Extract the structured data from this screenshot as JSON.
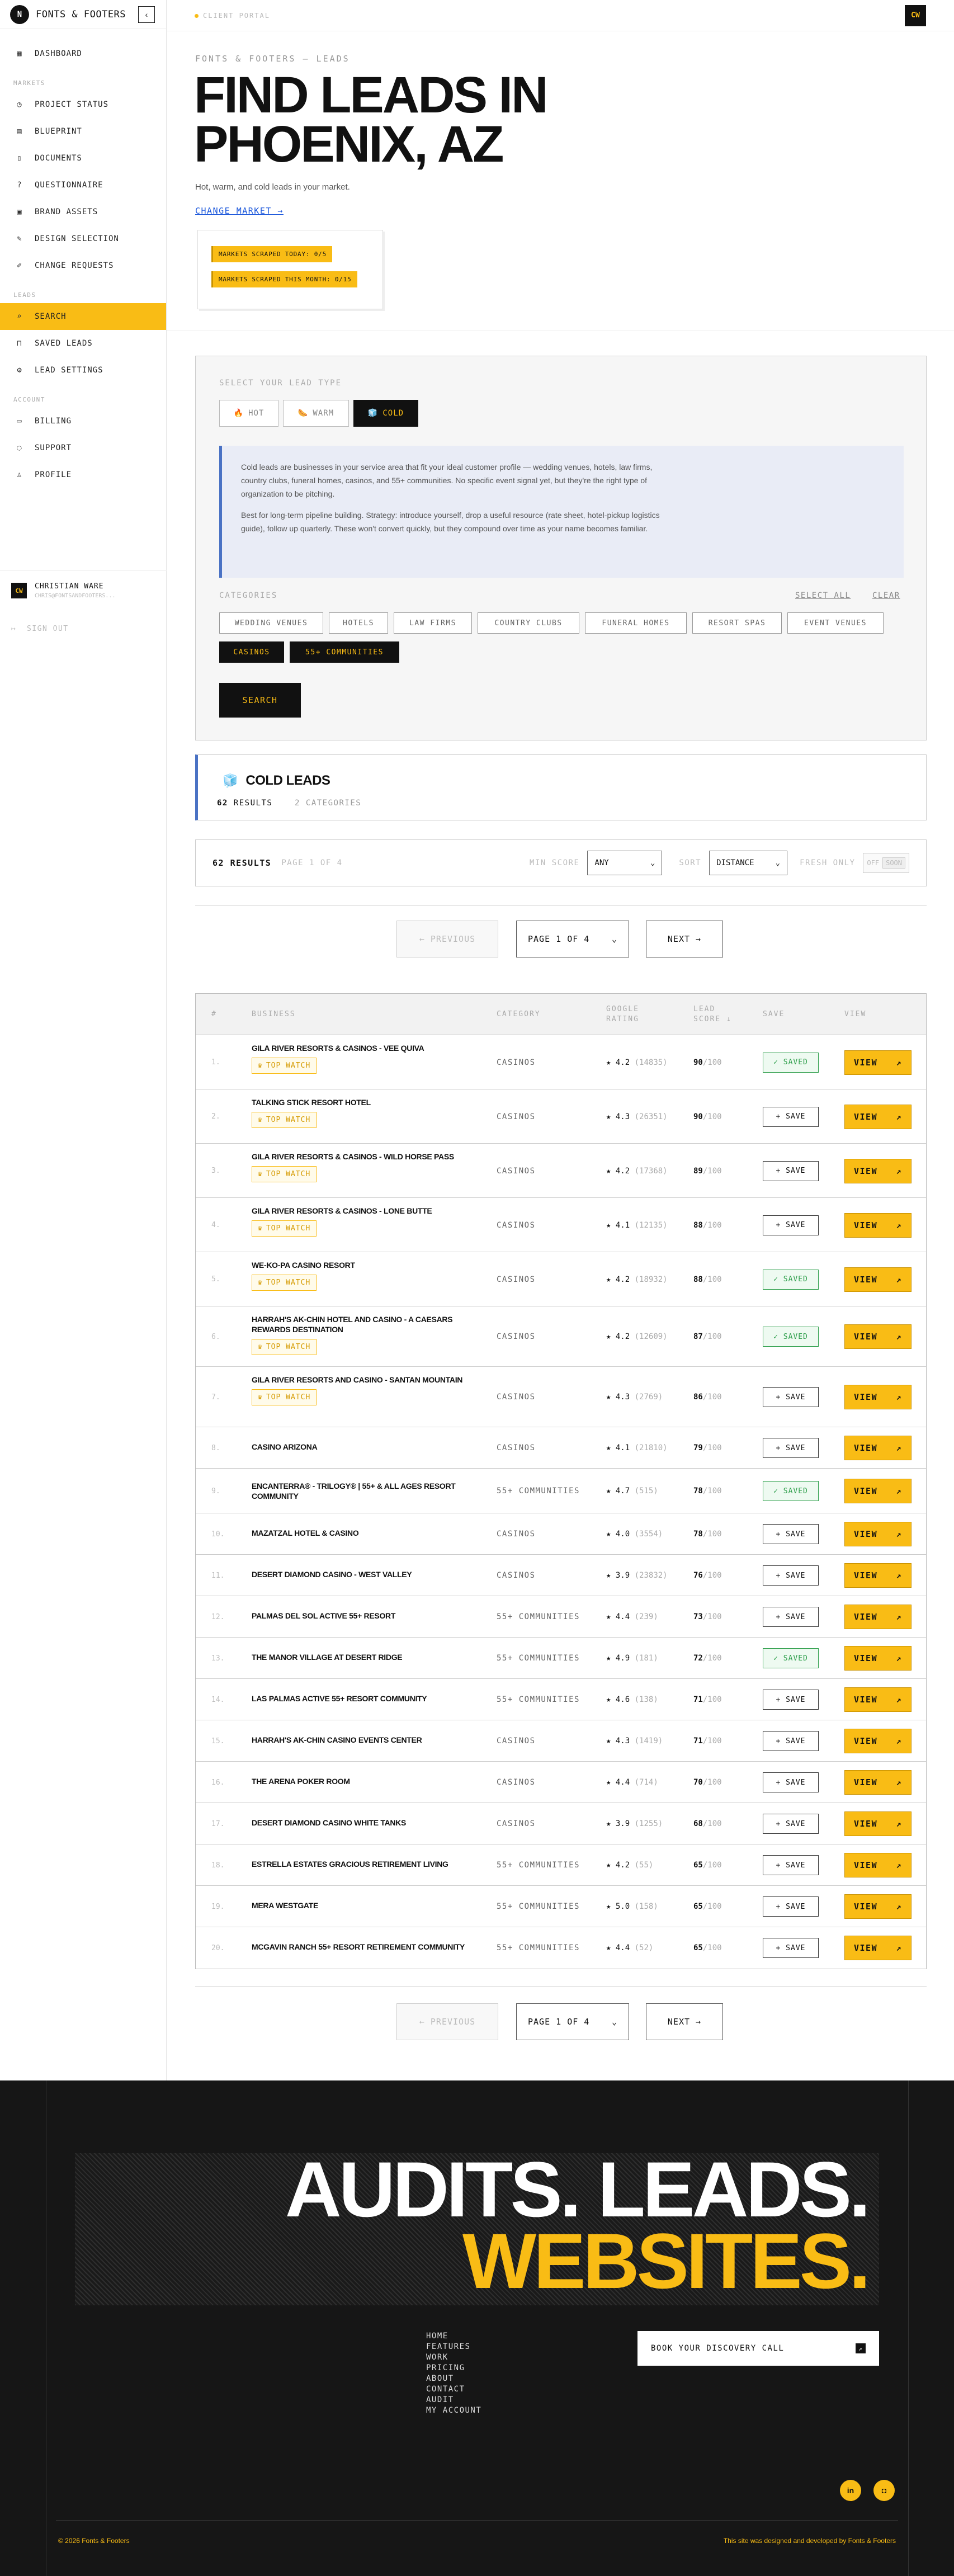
{
  "sidebar": {
    "logo_letter": "N",
    "brand": "FONTS & FOOTERS",
    "collapse_icon": "chevron-left-icon",
    "top_items": [
      {
        "label": "DASHBOARD",
        "icon": "grid-icon"
      }
    ],
    "markets_label": "MARKETS",
    "market_items": [
      {
        "label": "PROJECT STATUS",
        "icon": "clock-icon"
      },
      {
        "label": "BLUEPRINT",
        "icon": "layout-icon"
      },
      {
        "label": "DOCUMENTS",
        "icon": "document-icon"
      },
      {
        "label": "QUESTIONNAIRE",
        "icon": "question-icon"
      },
      {
        "label": "BRAND ASSETS",
        "icon": "image-icon"
      },
      {
        "label": "DESIGN SELECTION",
        "icon": "palette-icon"
      },
      {
        "label": "CHANGE REQUESTS",
        "icon": "edit-icon"
      }
    ],
    "leads_label": "LEADS",
    "lead_items": [
      {
        "label": "SEARCH",
        "icon": "search-icon"
      },
      {
        "label": "SAVED LEADS",
        "icon": "bookmark-icon"
      },
      {
        "label": "LEAD SETTINGS",
        "icon": "gear-icon"
      }
    ],
    "account_label": "ACCOUNT",
    "account_items": [
      {
        "label": "BILLING",
        "icon": "card-icon"
      },
      {
        "label": "SUPPORT",
        "icon": "chat-icon"
      },
      {
        "label": "PROFILE",
        "icon": "user-icon"
      }
    ],
    "user": {
      "initials": "CW",
      "name": "CHRISTIAN WARE",
      "email": "CHRIS@FONTSANDFOOTERS..."
    },
    "sign_out": "SIGN OUT"
  },
  "topbar": {
    "label": "CLIENT PORTAL",
    "avatar": "CW"
  },
  "header": {
    "breadcrumb": "FONTS & FOOTERS — LEADS",
    "title_line1": "FIND LEADS IN",
    "title_line2": "PHOENIX, AZ",
    "subtitle": "Hot, warm, and cold leads in your market.",
    "change_market": "CHANGE MARKET →",
    "scraped_today": "MARKETS SCRAPED TODAY: 0/5",
    "scraped_month": "MARKETS SCRAPED THIS MONTH: 0/15"
  },
  "search_panel": {
    "type_label": "SELECT YOUR LEAD TYPE",
    "types": [
      {
        "label": "HOT",
        "emoji": "🔥"
      },
      {
        "label": "WARM",
        "emoji": "🌭"
      },
      {
        "label": "COLD",
        "emoji": "🧊"
      }
    ],
    "selected_type": "COLD",
    "info_p1": "Cold leads are businesses in your service area that fit your ideal customer profile — wedding venues, hotels, law firms, country clubs, funeral homes, casinos, and 55+ communities. No specific event signal yet, but they're the right type of organization to be pitching.",
    "info_p2": "Best for long-term pipeline building. Strategy: introduce yourself, drop a useful resource (rate sheet, hotel-pickup logistics guide), follow up quarterly. These won't convert quickly, but they compound over time as your name becomes familiar.",
    "categories_label": "CATEGORIES",
    "select_all": "SELECT ALL",
    "clear": "CLEAR",
    "categories": [
      "WEDDING VENUES",
      "HOTELS",
      "LAW FIRMS",
      "COUNTRY CLUBS",
      "FUNERAL HOMES",
      "RESORT SPAS",
      "EVENT VENUES",
      "CASINOS",
      "55+ COMMUNITIES"
    ],
    "selected_categories": [
      "CASINOS",
      "55+ COMMUNITIES"
    ],
    "search_button": "SEARCH"
  },
  "results": {
    "emoji": "🧊",
    "title": "COLD LEADS",
    "count": "62",
    "count_label": "RESULTS",
    "categories_count": "2 CATEGORIES",
    "bar_count": "62 RESULTS",
    "bar_page": "PAGE 1 OF 4",
    "min_score_label": "MIN SCORE",
    "min_score_value": "ANY",
    "sort_label": "SORT",
    "sort_value": "DISTANCE",
    "fresh_label": "FRESH ONLY",
    "fresh_off": "OFF",
    "fresh_soon": "SOON",
    "prev": "← PREVIOUS",
    "page_select": "PAGE 1 OF 4",
    "next": "NEXT →"
  },
  "table": {
    "headers": {
      "num": "#",
      "business": "BUSINESS",
      "category": "CATEGORY",
      "rating": "GOOGLE RATING",
      "score": "LEAD SCORE ↓",
      "save": "SAVE",
      "view": "VIEW"
    },
    "top_watch": "TOP WATCH",
    "save_label": "+ SAVE",
    "saved_label": "✓ SAVED",
    "view_label": "VIEW",
    "score_suffix": "/100",
    "rows": [
      {
        "n": "1.",
        "name": "GILA RIVER RESORTS & CASINOS - VEE QUIVA",
        "watch": true,
        "cat": "CASINOS",
        "rating": "4.2",
        "reviews": "(14835)",
        "score": "90",
        "saved": true
      },
      {
        "n": "2.",
        "name": "TALKING STICK RESORT HOTEL",
        "watch": true,
        "cat": "CASINOS",
        "rating": "4.3",
        "reviews": "(26351)",
        "score": "90",
        "saved": false
      },
      {
        "n": "3.",
        "name": "GILA RIVER RESORTS & CASINOS - WILD HORSE PASS",
        "watch": true,
        "cat": "CASINOS",
        "rating": "4.2",
        "reviews": "(17368)",
        "score": "89",
        "saved": false
      },
      {
        "n": "4.",
        "name": "GILA RIVER RESORTS & CASINOS - LONE BUTTE",
        "watch": true,
        "cat": "CASINOS",
        "rating": "4.1",
        "reviews": "(12135)",
        "score": "88",
        "saved": false
      },
      {
        "n": "5.",
        "name": "WE-KO-PA CASINO RESORT",
        "watch": true,
        "cat": "CASINOS",
        "rating": "4.2",
        "reviews": "(18932)",
        "score": "88",
        "saved": true
      },
      {
        "n": "6.",
        "name": "HARRAH'S AK-CHIN HOTEL AND CASINO - A CAESARS REWARDS DESTINATION",
        "watch": true,
        "cat": "CASINOS",
        "rating": "4.2",
        "reviews": "(12609)",
        "score": "87",
        "saved": true
      },
      {
        "n": "7.",
        "name": "GILA RIVER RESORTS AND CASINO - SANTAN MOUNTAIN",
        "watch": true,
        "cat": "CASINOS",
        "rating": "4.3",
        "reviews": "(2769)",
        "score": "86",
        "saved": false
      },
      {
        "n": "8.",
        "name": "CASINO ARIZONA",
        "watch": false,
        "cat": "CASINOS",
        "rating": "4.1",
        "reviews": "(21810)",
        "score": "79",
        "saved": false
      },
      {
        "n": "9.",
        "name": "ENCANTERRA® - TRILOGY® | 55+ & ALL AGES RESORT COMMUNITY",
        "watch": false,
        "cat": "55+ COMMUNITIES",
        "rating": "4.7",
        "reviews": "(515)",
        "score": "78",
        "saved": true
      },
      {
        "n": "10.",
        "name": "MAZATZAL HOTEL & CASINO",
        "watch": false,
        "cat": "CASINOS",
        "rating": "4.0",
        "reviews": "(3554)",
        "score": "78",
        "saved": false
      },
      {
        "n": "11.",
        "name": "DESERT DIAMOND CASINO - WEST VALLEY",
        "watch": false,
        "cat": "CASINOS",
        "rating": "3.9",
        "reviews": "(23832)",
        "score": "76",
        "saved": false
      },
      {
        "n": "12.",
        "name": "PALMAS DEL SOL ACTIVE 55+ RESORT",
        "watch": false,
        "cat": "55+ COMMUNITIES",
        "rating": "4.4",
        "reviews": "(239)",
        "score": "73",
        "saved": false
      },
      {
        "n": "13.",
        "name": "THE MANOR VILLAGE AT DESERT RIDGE",
        "watch": false,
        "cat": "55+ COMMUNITIES",
        "rating": "4.9",
        "reviews": "(181)",
        "score": "72",
        "saved": true
      },
      {
        "n": "14.",
        "name": "LAS PALMAS ACTIVE 55+ RESORT COMMUNITY",
        "watch": false,
        "cat": "55+ COMMUNITIES",
        "rating": "4.6",
        "reviews": "(138)",
        "score": "71",
        "saved": false
      },
      {
        "n": "15.",
        "name": "HARRAH'S AK-CHIN CASINO EVENTS CENTER",
        "watch": false,
        "cat": "CASINOS",
        "rating": "4.3",
        "reviews": "(1419)",
        "score": "71",
        "saved": false
      },
      {
        "n": "16.",
        "name": "THE ARENA POKER ROOM",
        "watch": false,
        "cat": "CASINOS",
        "rating": "4.4",
        "reviews": "(714)",
        "score": "70",
        "saved": false
      },
      {
        "n": "17.",
        "name": "DESERT DIAMOND CASINO WHITE TANKS",
        "watch": false,
        "cat": "CASINOS",
        "rating": "3.9",
        "reviews": "(1255)",
        "score": "68",
        "saved": false
      },
      {
        "n": "18.",
        "name": "ESTRELLA ESTATES GRACIOUS RETIREMENT LIVING",
        "watch": false,
        "cat": "55+ COMMUNITIES",
        "rating": "4.2",
        "reviews": "(55)",
        "score": "65",
        "saved": false
      },
      {
        "n": "19.",
        "name": "MERA WESTGATE",
        "watch": false,
        "cat": "55+ COMMUNITIES",
        "rating": "5.0",
        "reviews": "(158)",
        "score": "65",
        "saved": false
      },
      {
        "n": "20.",
        "name": "MCGAVIN RANCH 55+ RESORT RETIREMENT COMMUNITY",
        "watch": false,
        "cat": "55+ COMMUNITIES",
        "rating": "4.4",
        "reviews": "(52)",
        "score": "65",
        "saved": false
      }
    ]
  },
  "footer": {
    "headline1": "AUDITS. LEADS.",
    "headline2": "WEBSITES.",
    "links": [
      "HOME",
      "FEATURES",
      "WORK",
      "PRICING",
      "ABOUT",
      "CONTACT",
      "AUDIT",
      "MY ACCOUNT"
    ],
    "cta": "BOOK YOUR DISCOVERY CALL",
    "copyright": "© 2026 Fonts & Footers",
    "credit": "This site was designed and developed by Fonts & Footers",
    "social": [
      "in",
      "◘"
    ]
  },
  "colors": {
    "accent": "#F9BC15",
    "dark": "#161616",
    "info_blue": "#4a72c4",
    "saved_green": "#2a9d48"
  }
}
